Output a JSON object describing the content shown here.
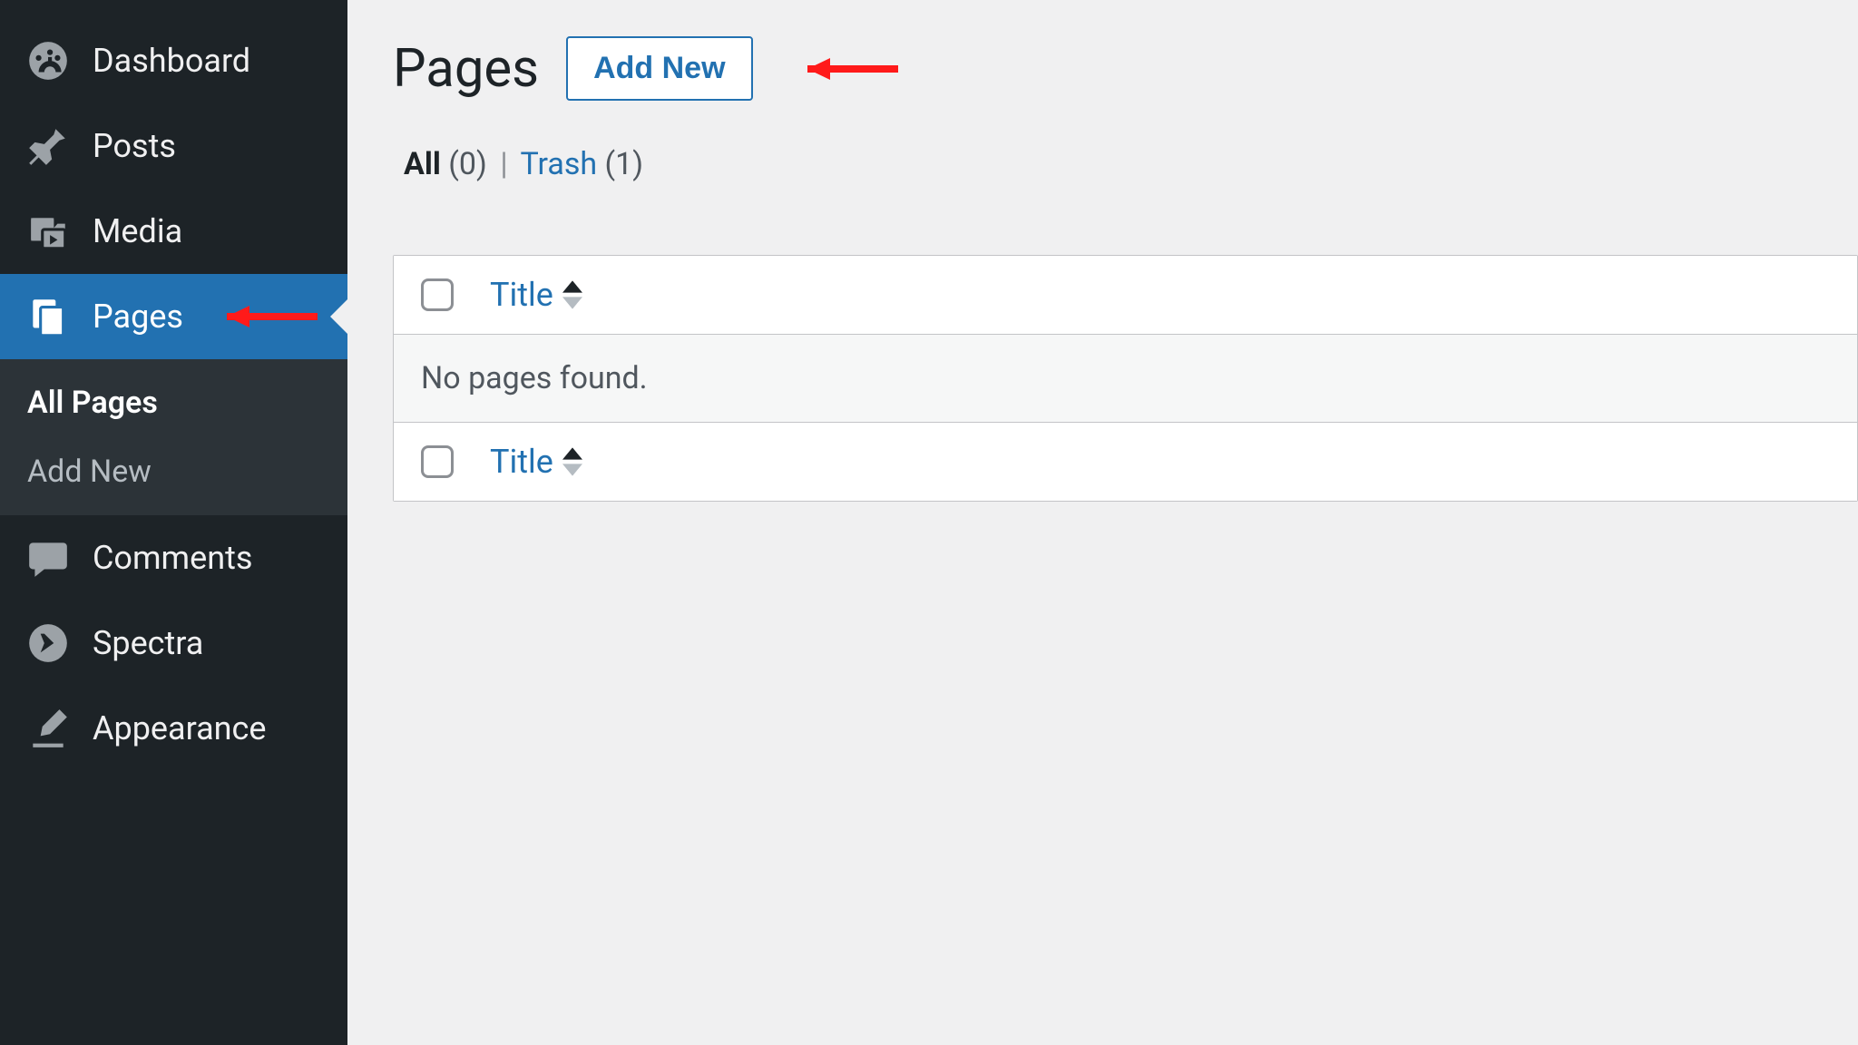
{
  "sidebar": {
    "items": {
      "dashboard": "Dashboard",
      "posts": "Posts",
      "media": "Media",
      "pages": "Pages",
      "comments": "Comments",
      "spectra": "Spectra",
      "appearance": "Appearance"
    },
    "submenu": {
      "all_pages": "All Pages",
      "add_new": "Add New"
    }
  },
  "main": {
    "title": "Pages",
    "add_new_button": "Add New",
    "filters": {
      "all_label": "All",
      "all_count": "(0)",
      "trash_label": "Trash",
      "trash_count": "(1)"
    },
    "table": {
      "title_column": "Title",
      "empty_message": "No pages found."
    }
  }
}
